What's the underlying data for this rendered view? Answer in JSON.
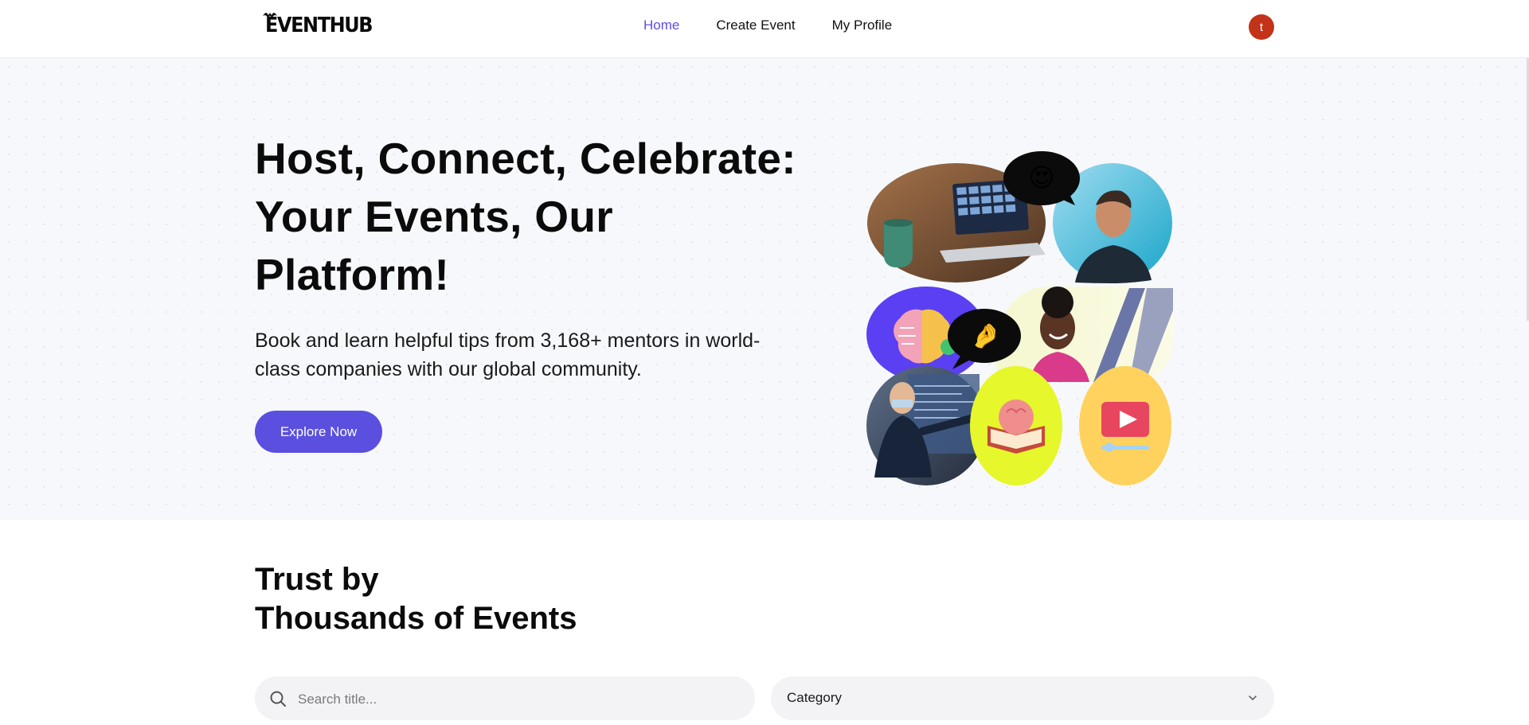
{
  "header": {
    "logo_text": "EVENTHUB",
    "nav": {
      "home": "Home",
      "create_event": "Create Event",
      "my_profile": "My Profile"
    },
    "avatar_initial": "t"
  },
  "hero": {
    "title": "Host, Connect, Celebrate: Your Events, Our Platform!",
    "subtitle": "Book and learn helpful tips from 3,168+ mentors in world-class companies with our global community.",
    "cta_label": "Explore Now"
  },
  "trust": {
    "title_line1": "Trust by",
    "title_line2": "Thousands of Events"
  },
  "filters": {
    "search_placeholder": "Search title...",
    "category_label": "Category"
  },
  "colors": {
    "accent": "#5b4fe0",
    "avatar": "#c2331a",
    "hero_bg": "#f7f8fc"
  },
  "collage_emojis": {
    "heart_eyes": "😍",
    "pinch": "🤌"
  }
}
